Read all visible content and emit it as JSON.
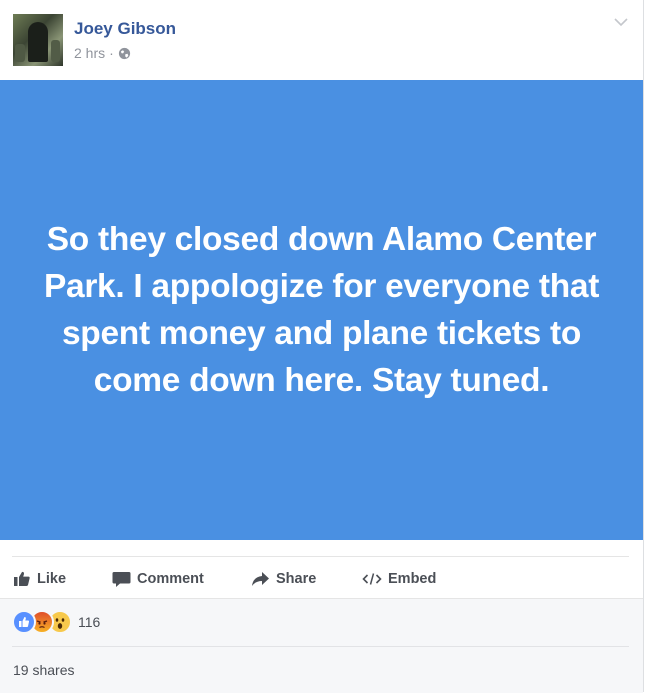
{
  "post": {
    "author": "Joey Gibson",
    "timestamp": "2 hrs",
    "separator": "·",
    "privacy_icon": "globe-icon",
    "menu_icon": "chevron-down-icon",
    "banner_color": "#4a90e2",
    "banner_text": "So they closed down Alamo Center Park. I appologize for everyone that spent money and plane tickets to come down here. Stay tuned."
  },
  "actions": [
    {
      "label": "Like",
      "icon": "thumbs-up-icon"
    },
    {
      "label": "Comment",
      "icon": "comment-icon"
    },
    {
      "label": "Share",
      "icon": "share-arrow-icon"
    },
    {
      "label": "Embed",
      "icon": "code-icon"
    }
  ],
  "engagement": {
    "reactions": [
      "like",
      "angry",
      "wow"
    ],
    "reaction_count": "116",
    "shares": "19 shares"
  },
  "colors": {
    "link": "#365899",
    "muted": "#90949c",
    "like_blue": "#5890ff"
  }
}
